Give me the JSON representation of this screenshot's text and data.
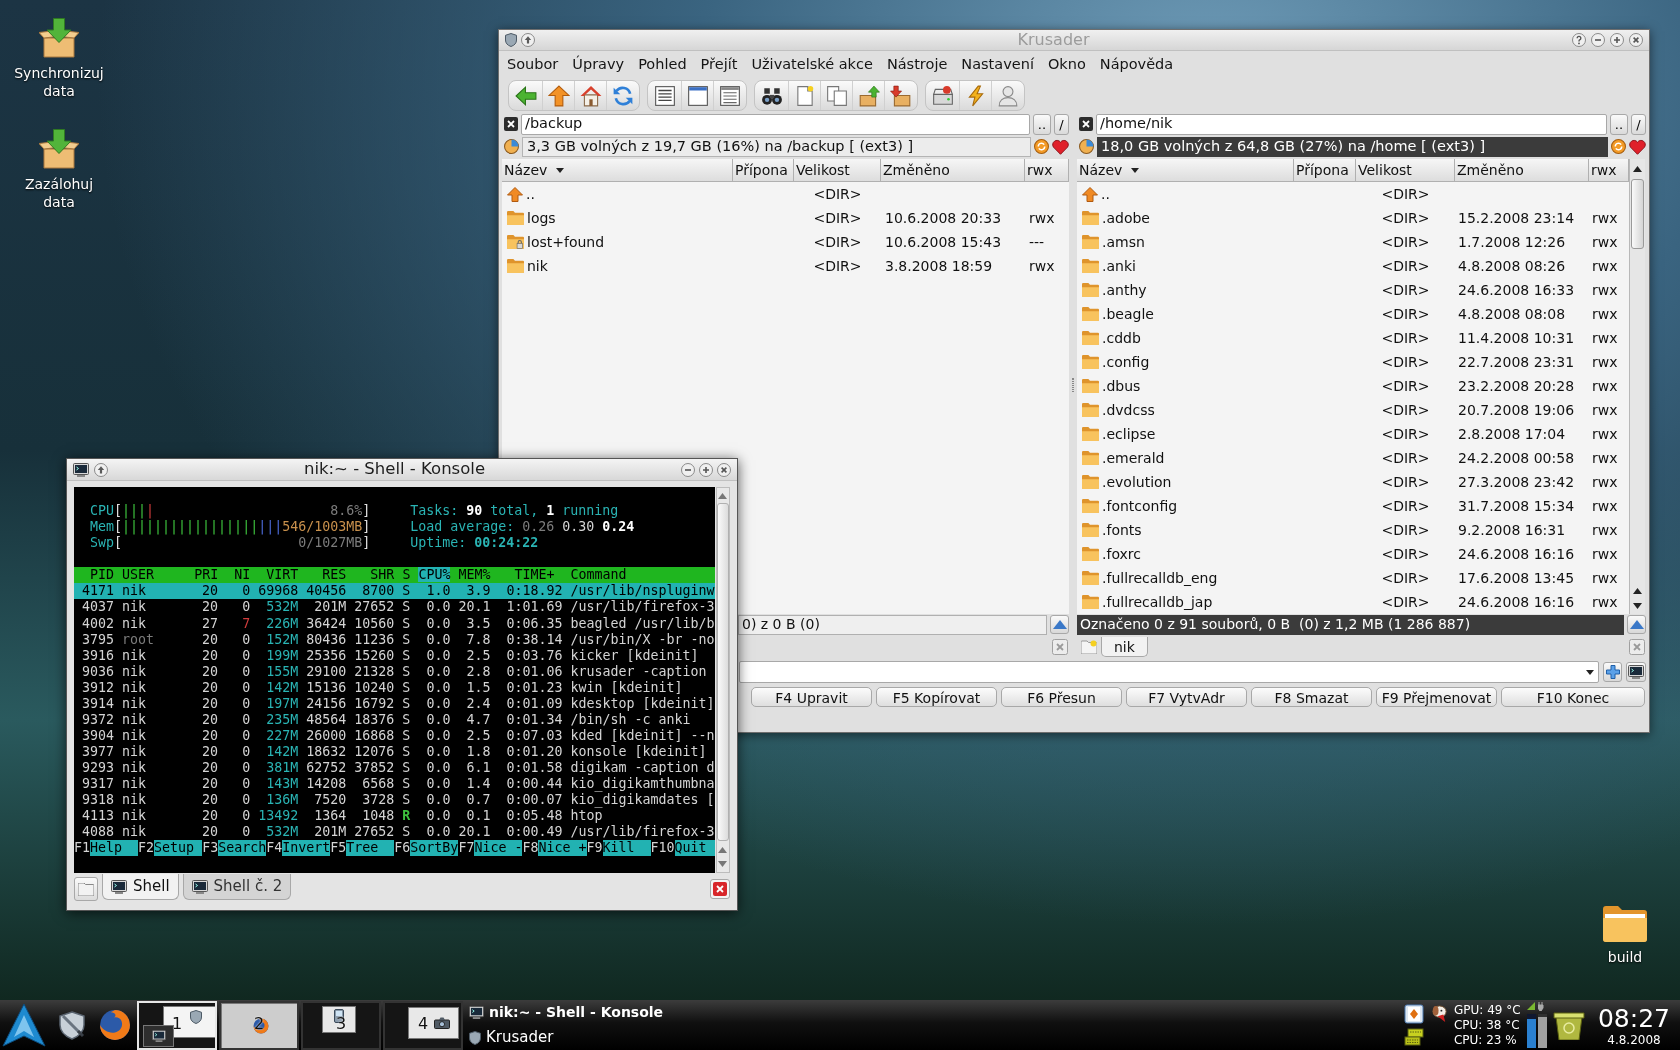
{
  "desktop_icons": [
    {
      "label": "Synchronizuj data",
      "kind": "action"
    },
    {
      "label": "Zazálohuj data",
      "kind": "action"
    },
    {
      "label": "build",
      "kind": "folder"
    }
  ],
  "krusader": {
    "title": "Krusader",
    "active": false,
    "menu": [
      "Soubor",
      "Úpravy",
      "Pohled",
      "Přejít",
      "Uživatelské akce",
      "Nástroje",
      "Nastavení",
      "Okno",
      "Nápověda"
    ],
    "panels": [
      {
        "path": "/backup",
        "up_button": "..",
        "root_button": "/",
        "free_space": "3,3 GB volných z 19,7 GB (16%) na /backup [ (ext3) ]",
        "active": false,
        "columns": [
          "Název",
          "Přípona",
          "Velikost",
          "Změněno",
          "rwx"
        ],
        "rows": [
          {
            "name": "..",
            "kind": "parent",
            "size": "<DIR>"
          },
          {
            "name": "logs",
            "kind": "folder",
            "size": "<DIR>",
            "modified": "10.6.2008 20:33",
            "permissions": "rwx"
          },
          {
            "name": "lost+found",
            "kind": "locked",
            "size": "<DIR>",
            "modified": "10.6.2008 15:43",
            "permissions": "---"
          },
          {
            "name": "nik",
            "kind": "folder",
            "size": "<DIR>",
            "modified": "3.8.2008 18:59",
            "permissions": "rwx"
          }
        ],
        "status": "0) z 0 B (0)"
      },
      {
        "path": "/home/nik",
        "up_button": "..",
        "root_button": "/",
        "free_space": "18,0 GB volných z 64,8 GB (27%) na /home [ (ext3) ]",
        "active": true,
        "columns": [
          "Název",
          "Přípona",
          "Velikost",
          "Změněno",
          "rwx"
        ],
        "rows": [
          {
            "name": "..",
            "kind": "parent",
            "size": "<DIR>"
          },
          {
            "name": ".adobe",
            "kind": "folder",
            "size": "<DIR>",
            "modified": "15.2.2008 23:14",
            "permissions": "rwx"
          },
          {
            "name": ".amsn",
            "kind": "folder",
            "size": "<DIR>",
            "modified": "1.7.2008 12:26",
            "permissions": "rwx"
          },
          {
            "name": ".anki",
            "kind": "folder",
            "size": "<DIR>",
            "modified": "4.8.2008 08:26",
            "permissions": "rwx"
          },
          {
            "name": ".anthy",
            "kind": "folder",
            "size": "<DIR>",
            "modified": "24.6.2008 16:33",
            "permissions": "rwx"
          },
          {
            "name": ".beagle",
            "kind": "folder",
            "size": "<DIR>",
            "modified": "4.8.2008 08:08",
            "permissions": "rwx"
          },
          {
            "name": ".cddb",
            "kind": "folder",
            "size": "<DIR>",
            "modified": "11.4.2008 10:31",
            "permissions": "rwx"
          },
          {
            "name": ".config",
            "kind": "folder",
            "size": "<DIR>",
            "modified": "22.7.2008 23:31",
            "permissions": "rwx"
          },
          {
            "name": ".dbus",
            "kind": "folder",
            "size": "<DIR>",
            "modified": "23.2.2008 20:28",
            "permissions": "rwx"
          },
          {
            "name": ".dvdcss",
            "kind": "folder",
            "size": "<DIR>",
            "modified": "20.7.2008 19:06",
            "permissions": "rwx"
          },
          {
            "name": ".eclipse",
            "kind": "folder",
            "size": "<DIR>",
            "modified": "2.8.2008 17:04",
            "permissions": "rwx"
          },
          {
            "name": ".emerald",
            "kind": "folder",
            "size": "<DIR>",
            "modified": "24.2.2008 00:58",
            "permissions": "rwx"
          },
          {
            "name": ".evolution",
            "kind": "folder",
            "size": "<DIR>",
            "modified": "27.3.2008 23:42",
            "permissions": "rwx"
          },
          {
            "name": ".fontconfig",
            "kind": "folder",
            "size": "<DIR>",
            "modified": "31.7.2008 15:34",
            "permissions": "rwx"
          },
          {
            "name": ".fonts",
            "kind": "folder",
            "size": "<DIR>",
            "modified": "9.2.2008 16:31",
            "permissions": "rwx"
          },
          {
            "name": ".foxrc",
            "kind": "folder",
            "size": "<DIR>",
            "modified": "24.6.2008 16:16",
            "permissions": "rwx"
          },
          {
            "name": ".fullrecalldb_eng",
            "kind": "folder",
            "size": "<DIR>",
            "modified": "17.6.2008 13:45",
            "permissions": "rwx"
          },
          {
            "name": ".fullrecalldb_jap",
            "kind": "folder",
            "size": "<DIR>",
            "modified": "24.6.2008 16:16",
            "permissions": "rwx"
          }
        ],
        "status": "Označeno 0 z 91 souborů, 0 B  (0) z 1,2 MB (1 286 887)",
        "tabs": [
          {
            "label": "nik",
            "selected": true
          }
        ]
      }
    ],
    "function_keys": [
      "F4 Upravit",
      "F5 Kopírovat",
      "F6 Přesun",
      "F7 VytvAdr",
      "F8 Smazat",
      "F9 Přejmenovat",
      "F10 Konec"
    ]
  },
  "konsole": {
    "title": "nik:~ - Shell - Konsole",
    "active": true,
    "htop": {
      "meters": [
        {
          "label": "CPU[",
          "bars": [
            {
              "text": "|||",
              "kind": "normal"
            },
            {
              "text": "|",
              "kind": "kernel"
            }
          ],
          "value": {
            "text": "8.6%]",
            "kind": "dim"
          }
        },
        {
          "label": "Mem[",
          "bars": [
            {
              "text": "|||||||||||||||||",
              "kind": "normal"
            },
            {
              "text": "|||",
              "kind": "buffers"
            }
          ],
          "value": {
            "text": "546/1003MB]",
            "kind": "cache"
          }
        },
        {
          "label": "Swp[",
          "value": {
            "text": "0/1027MB]",
            "kind": "dim"
          }
        }
      ],
      "summary": [
        [
          {
            "text": "Tasks: ",
            "kind": "label"
          },
          {
            "text": "90",
            "kind": "value"
          },
          {
            "text": " total, ",
            "kind": "label"
          },
          {
            "text": "1",
            "kind": "value"
          },
          {
            "text": " running",
            "kind": "label"
          }
        ],
        [
          {
            "text": "Load average: ",
            "kind": "label"
          },
          {
            "text": "0.26",
            "kind": "dim"
          },
          {
            "text": " 0.30",
            "kind": "plain"
          },
          {
            "text": " 0.24",
            "kind": "value"
          }
        ],
        [
          {
            "text": "Uptime: ",
            "kind": "label"
          },
          {
            "text": "00:24:22",
            "kind": "highlight"
          }
        ]
      ],
      "columns": [
        {
          "label": "PID",
          "sorted": false
        },
        {
          "label": "USER",
          "sorted": false
        },
        {
          "label": "PRI",
          "sorted": false
        },
        {
          "label": "NI",
          "sorted": false
        },
        {
          "label": "VIRT",
          "sorted": false
        },
        {
          "label": "RES",
          "sorted": false
        },
        {
          "label": "SHR",
          "sorted": false
        },
        {
          "label": "S",
          "sorted": false
        },
        {
          "label": "CPU%",
          "sorted": true
        },
        {
          "label": "MEM%",
          "sorted": false
        },
        {
          "label": "TIME+",
          "sorted": false
        },
        {
          "label": "Command",
          "sorted": false
        }
      ],
      "processes": [
        {
          "cells": [
            "4171",
            "nik",
            "20",
            "0",
            "69968",
            "40456",
            "8700",
            "S",
            "1.0",
            "3.9",
            "0:18.92",
            "/usr/lib/nspluginw"
          ],
          "selected": true,
          "running": false,
          "niced": false,
          "other_user": false
        },
        {
          "cells": [
            "4037",
            "nik",
            "20",
            "0",
            "532M",
            "201M",
            "27652",
            "S",
            "0.0",
            "20.1",
            "1:01.69",
            "/usr/lib/firefox-3"
          ],
          "selected": false,
          "running": false,
          "niced": false,
          "other_user": false
        },
        {
          "cells": [
            "4002",
            "nik",
            "27",
            "7",
            "226M",
            "36424",
            "10560",
            "S",
            "0.0",
            "3.5",
            "0:06.35",
            "beagled /usr/lib/b"
          ],
          "selected": false,
          "running": false,
          "niced": true,
          "other_user": false
        },
        {
          "cells": [
            "3795",
            "root",
            "20",
            "0",
            "152M",
            "80436",
            "11236",
            "S",
            "0.0",
            "7.8",
            "0:38.14",
            "/usr/bin/X -br -no"
          ],
          "selected": false,
          "running": false,
          "niced": false,
          "other_user": true
        },
        {
          "cells": [
            "3916",
            "nik",
            "20",
            "0",
            "199M",
            "25356",
            "15260",
            "S",
            "0.0",
            "2.5",
            "0:03.76",
            "kicker [kdeinit]"
          ],
          "selected": false,
          "running": false,
          "niced": false,
          "other_user": false
        },
        {
          "cells": [
            "9036",
            "nik",
            "20",
            "0",
            "155M",
            "29100",
            "21328",
            "S",
            "0.0",
            "2.8",
            "0:01.06",
            "krusader -caption"
          ],
          "selected": false,
          "running": false,
          "niced": false,
          "other_user": false
        },
        {
          "cells": [
            "3912",
            "nik",
            "20",
            "0",
            "142M",
            "15136",
            "10240",
            "S",
            "0.0",
            "1.5",
            "0:01.23",
            "kwin [kdeinit]"
          ],
          "selected": false,
          "running": false,
          "niced": false,
          "other_user": false
        },
        {
          "cells": [
            "3914",
            "nik",
            "20",
            "0",
            "197M",
            "24156",
            "16792",
            "S",
            "0.0",
            "2.4",
            "0:01.09",
            "kdesktop [kdeinit]"
          ],
          "selected": false,
          "running": false,
          "niced": false,
          "other_user": false
        },
        {
          "cells": [
            "9372",
            "nik",
            "20",
            "0",
            "235M",
            "48564",
            "18376",
            "S",
            "0.0",
            "4.7",
            "0:01.34",
            "/bin/sh -c anki"
          ],
          "selected": false,
          "running": false,
          "niced": false,
          "other_user": false
        },
        {
          "cells": [
            "3904",
            "nik",
            "20",
            "0",
            "227M",
            "26000",
            "16868",
            "S",
            "0.0",
            "2.5",
            "0:07.03",
            "kded [kdeinit] --n"
          ],
          "selected": false,
          "running": false,
          "niced": false,
          "other_user": false
        },
        {
          "cells": [
            "3977",
            "nik",
            "20",
            "0",
            "142M",
            "18632",
            "12076",
            "S",
            "0.0",
            "1.8",
            "0:01.20",
            "konsole [kdeinit]"
          ],
          "selected": false,
          "running": false,
          "niced": false,
          "other_user": false
        },
        {
          "cells": [
            "9293",
            "nik",
            "20",
            "0",
            "381M",
            "62752",
            "37852",
            "S",
            "0.0",
            "6.1",
            "0:01.58",
            "digikam -caption d"
          ],
          "selected": false,
          "running": false,
          "niced": false,
          "other_user": false
        },
        {
          "cells": [
            "9317",
            "nik",
            "20",
            "0",
            "143M",
            "14208",
            "6568",
            "S",
            "0.0",
            "1.4",
            "0:00.44",
            "kio_digikamthumbna"
          ],
          "selected": false,
          "running": false,
          "niced": false,
          "other_user": false
        },
        {
          "cells": [
            "9318",
            "nik",
            "20",
            "0",
            "136M",
            "7520",
            "3728",
            "S",
            "0.0",
            "0.7",
            "0:00.07",
            "kio_digikamdates ["
          ],
          "selected": false,
          "running": false,
          "niced": false,
          "other_user": false
        },
        {
          "cells": [
            "4113",
            "nik",
            "20",
            "0",
            "13492",
            "1364",
            "1048",
            "R",
            "0.0",
            "0.1",
            "0:05.48",
            "htop"
          ],
          "selected": false,
          "running": true,
          "niced": false,
          "other_user": false
        },
        {
          "cells": [
            "4088",
            "nik",
            "20",
            "0",
            "532M",
            "201M",
            "27652",
            "S",
            "0.0",
            "20.1",
            "0:00.49",
            "/usr/lib/firefox-3"
          ],
          "selected": false,
          "running": false,
          "niced": false,
          "other_user": false
        }
      ],
      "function_keys": [
        {
          "key": "F1",
          "label": "Help"
        },
        {
          "key": "F2",
          "label": "Setup"
        },
        {
          "key": "F3",
          "label": "Search"
        },
        {
          "key": "F4",
          "label": "Invert"
        },
        {
          "key": "F5",
          "label": "Tree"
        },
        {
          "key": "F6",
          "label": "SortBy"
        },
        {
          "key": "F7",
          "label": "Nice -"
        },
        {
          "key": "F8",
          "label": "Nice +"
        },
        {
          "key": "F9",
          "label": "Kill"
        },
        {
          "key": "F10",
          "label": "Quit"
        }
      ]
    },
    "tabs": [
      {
        "label": "Shell",
        "selected": true
      },
      {
        "label": "Shell č. 2",
        "selected": false
      }
    ]
  },
  "taskbar": {
    "pager": [
      {
        "label": "1",
        "selected": true
      },
      {
        "label": "2",
        "selected": false
      },
      {
        "label": "3",
        "selected": false
      },
      {
        "label": "4",
        "selected": false
      }
    ],
    "tasks": [
      {
        "label": "nik:~ - Shell - Konsole",
        "active": true
      },
      {
        "label": "Krusader",
        "active": false
      }
    ],
    "sensors": [
      "GPU: 49 °C",
      "CPU: 38 °C",
      "CPU: 23 %"
    ],
    "clock": {
      "time": "08:27",
      "date": "4.8.2008"
    }
  }
}
